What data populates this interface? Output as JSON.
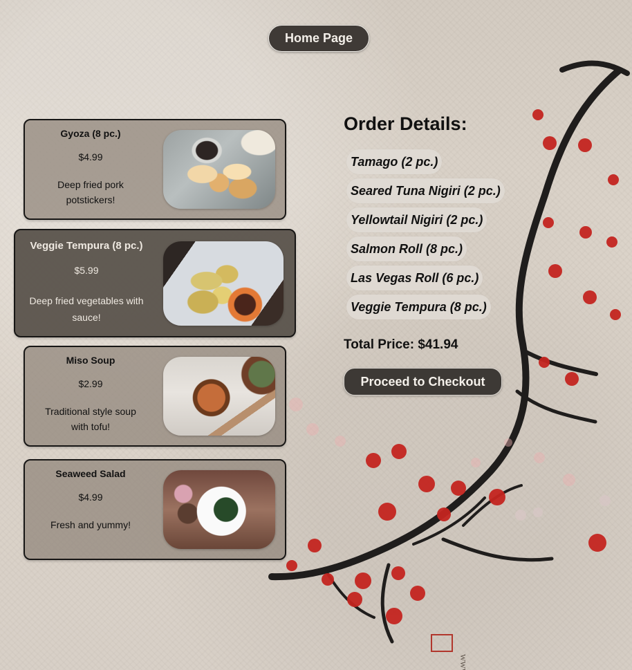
{
  "header": {
    "home_label": "Home Page"
  },
  "menu": {
    "items": [
      {
        "name": "Gyoza (8 pc.)",
        "price": "$4.99",
        "description": "Deep fried pork potstickers!"
      },
      {
        "name": "Veggie Tempura (8 pc.)",
        "price": "$5.99",
        "description": "Deep fried vegetables with sauce!"
      },
      {
        "name": "Miso Soup",
        "price": "$2.99",
        "description": "Traditional style soup with tofu!"
      },
      {
        "name": "Seaweed Salad",
        "price": "$4.99",
        "description": "Fresh and yummy!"
      }
    ]
  },
  "order": {
    "title": "Order Details:",
    "items": [
      "Tamago (2 pc.)",
      "Seared Tuna Nigiri (2 pc.)",
      "Yellowtail Nigiri (2 pc.)",
      "Salmon Roll (8 pc.)",
      "Las Vegas Roll (6 pc.)",
      "Veggie Tempura (8 pc.)"
    ],
    "total_label": "Total Price: $41.94",
    "checkout_label": "Proceed to Checkout"
  }
}
